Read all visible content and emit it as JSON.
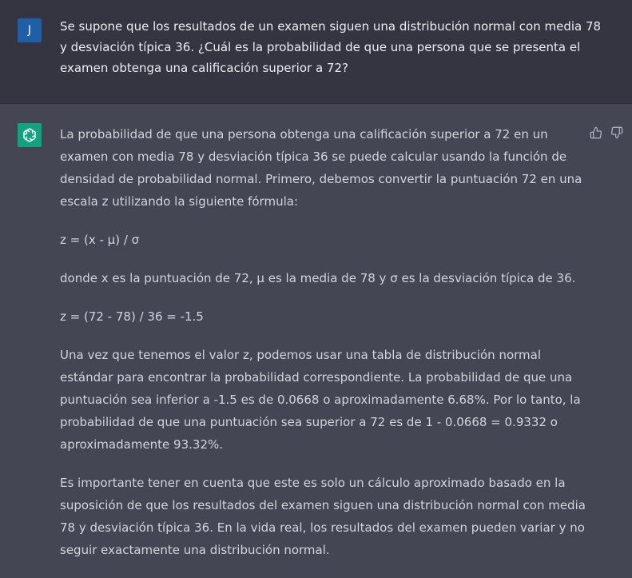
{
  "user": {
    "avatar_letter": "J",
    "avatar_color": "#1f5fa7",
    "message": "Se supone que los resultados de un examen siguen una distribución normal con media 78 y desviación típica 36.  ¿Cuál es la probabilidad de que una persona que se presenta el examen obtenga una calificación superior a 72?"
  },
  "assistant": {
    "avatar_icon": "openai-logo-icon",
    "avatar_color": "#10a37f",
    "paragraphs": [
      "La probabilidad de que una persona obtenga una calificación superior a 72 en un examen con media 78 y desviación típica 36 se puede calcular usando la función de densidad de probabilidad normal. Primero, debemos convertir la puntuación 72 en una escala z utilizando la siguiente fórmula:",
      "z = (x - μ) / σ",
      "donde x es la puntuación de 72, μ es la media de 78 y σ es la desviación típica de 36.",
      "z = (72 - 78) / 36 = -1.5",
      "Una vez que tenemos el valor z, podemos usar una tabla de distribución normal estándar para encontrar la probabilidad correspondiente. La probabilidad de que una puntuación sea inferior a -1.5 es de 0.0668 o aproximadamente 6.68%. Por lo tanto, la probabilidad de que una puntuación sea superior a 72 es de 1 - 0.0668 = 0.9332 o aproximadamente 93.32%.",
      "Es importante tener en cuenta que este es solo un cálculo aproximado basado en la suposición de que los resultados del examen siguen una distribución normal con media 78 y desviación típica 36. En la vida real, los resultados del examen pueden variar y no seguir exactamente una distribución normal."
    ]
  },
  "feedback": {
    "thumbs_up_icon": "thumbs-up-icon",
    "thumbs_down_icon": "thumbs-down-icon"
  },
  "colors": {
    "user_bg": "#343541",
    "assistant_bg": "#444654"
  }
}
